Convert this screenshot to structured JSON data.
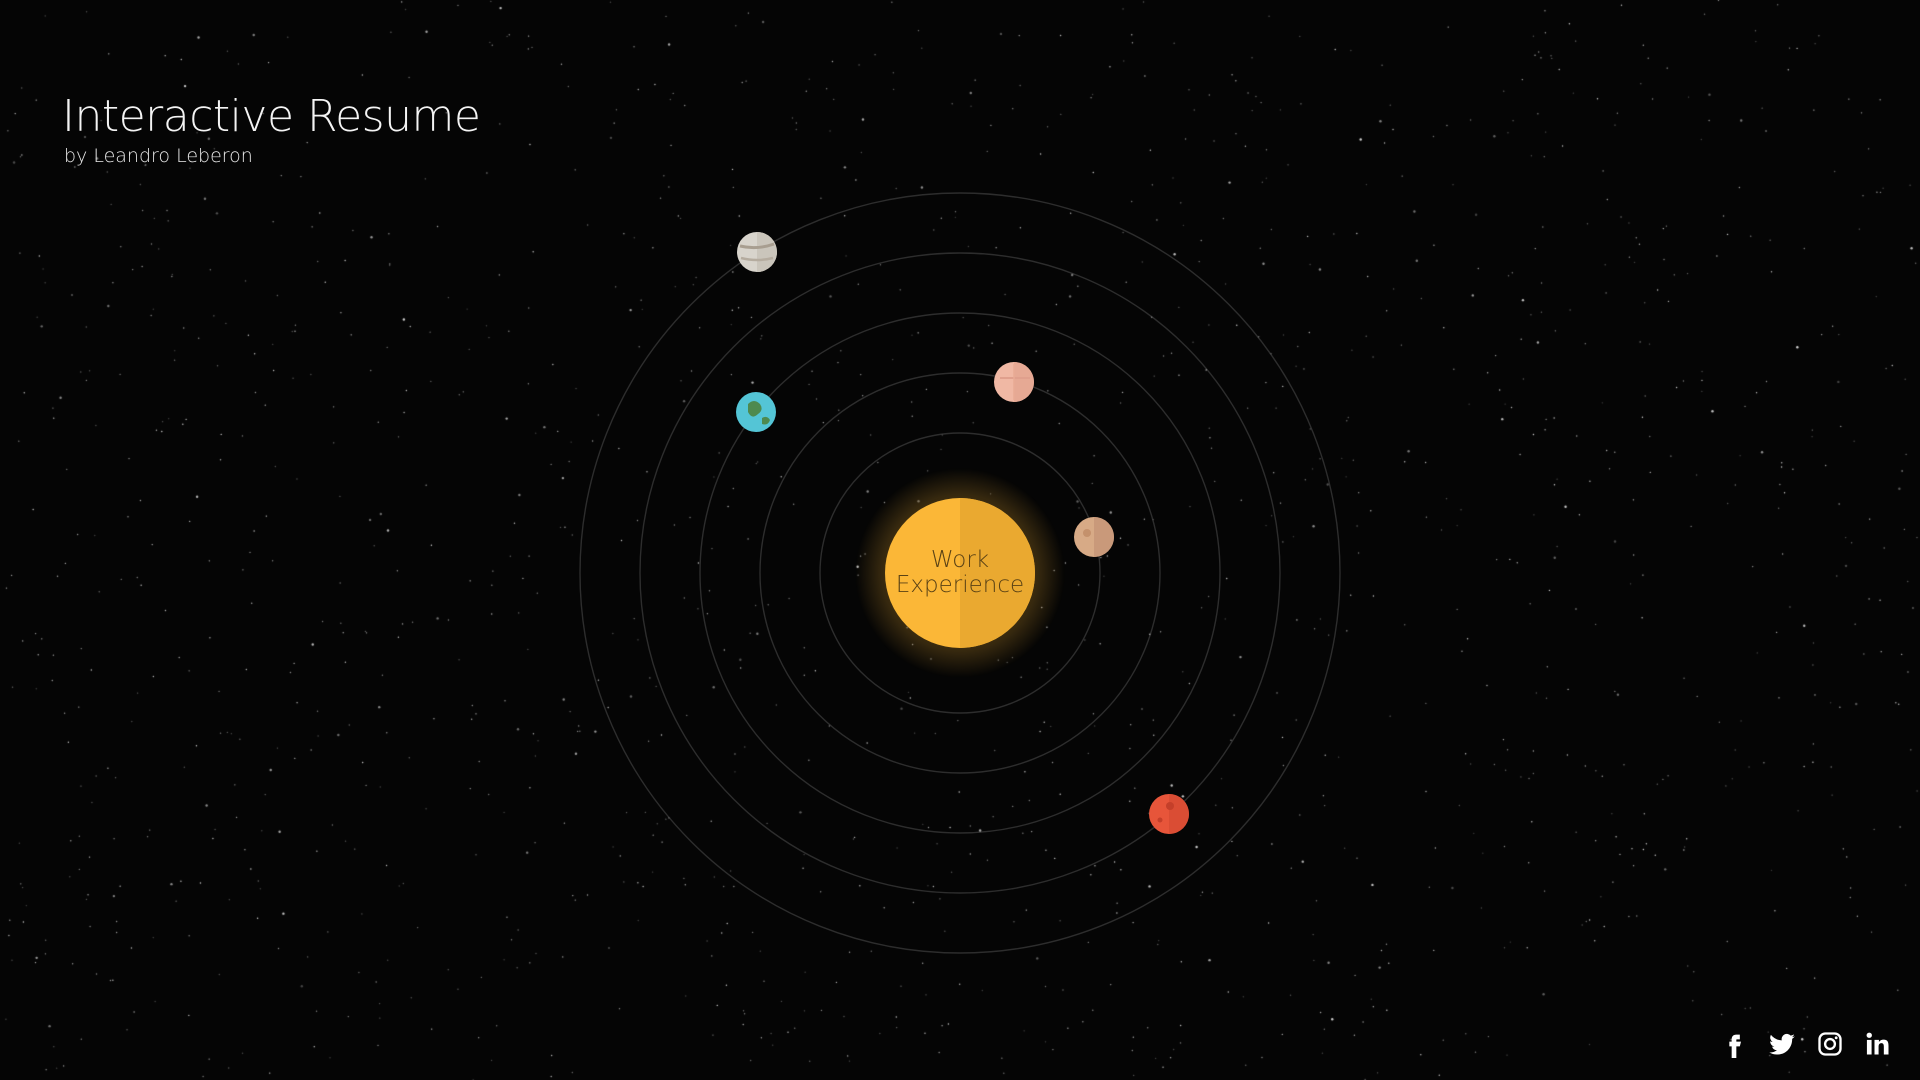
{
  "header": {
    "title": "Interactive Resume",
    "subtitle": "by Leandro Leberon"
  },
  "sun": {
    "label_line1": "Work",
    "label_line2": "Experience",
    "color": "#fbb737",
    "shade_color": "#eaa930"
  },
  "planets": [
    {
      "name": "venus-planet",
      "color": "#d7aa86",
      "accent": "#c4916c"
    },
    {
      "name": "mercury-planet",
      "color": "#f0b8a4",
      "accent": "#e0a08d"
    },
    {
      "name": "earth-planet",
      "color": "#54c5d6",
      "accent": "#4e8a4f"
    },
    {
      "name": "jupiter-planet",
      "color": "#d8d4cc",
      "accent": "#a89e90"
    },
    {
      "name": "mars-planet",
      "color": "#e7553a",
      "accent": "#c43f2a"
    }
  ],
  "socials": [
    {
      "name": "facebook-icon"
    },
    {
      "name": "twitter-icon"
    },
    {
      "name": "instagram-icon"
    },
    {
      "name": "linkedin-icon"
    }
  ],
  "colors": {
    "background": "#050505",
    "orbit": "rgba(255,255,255,0.16)",
    "text": "#ffffff"
  }
}
